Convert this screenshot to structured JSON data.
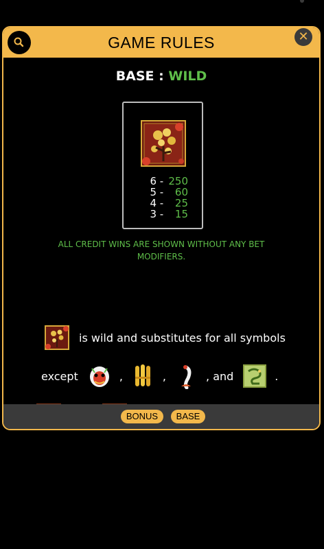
{
  "header": {
    "title": "GAME RULES"
  },
  "section": {
    "label": "BASE",
    "separator": ":",
    "name": "WILD"
  },
  "payouts": [
    {
      "count": "6",
      "value": "250"
    },
    {
      "count": "5",
      "value": "60"
    },
    {
      "count": "4",
      "value": "25"
    },
    {
      "count": "3",
      "value": "15"
    }
  ],
  "notice": "ALL CREDIT WINS ARE SHOWN WITHOUT ANY BET MODIFIERS.",
  "wild_text": "is wild and substitutes for all symbols",
  "except": {
    "label": "except",
    "comma": ",",
    "and": ", and",
    "period": "."
  },
  "tabs": [
    {
      "label": "BONUS"
    },
    {
      "label": "BASE"
    }
  ],
  "icons": {
    "search": "search-icon",
    "close": "close-icon"
  },
  "colors": {
    "accent": "#f3b84b",
    "highlight": "#5fbf4a",
    "panel": "#3a3a3a"
  }
}
